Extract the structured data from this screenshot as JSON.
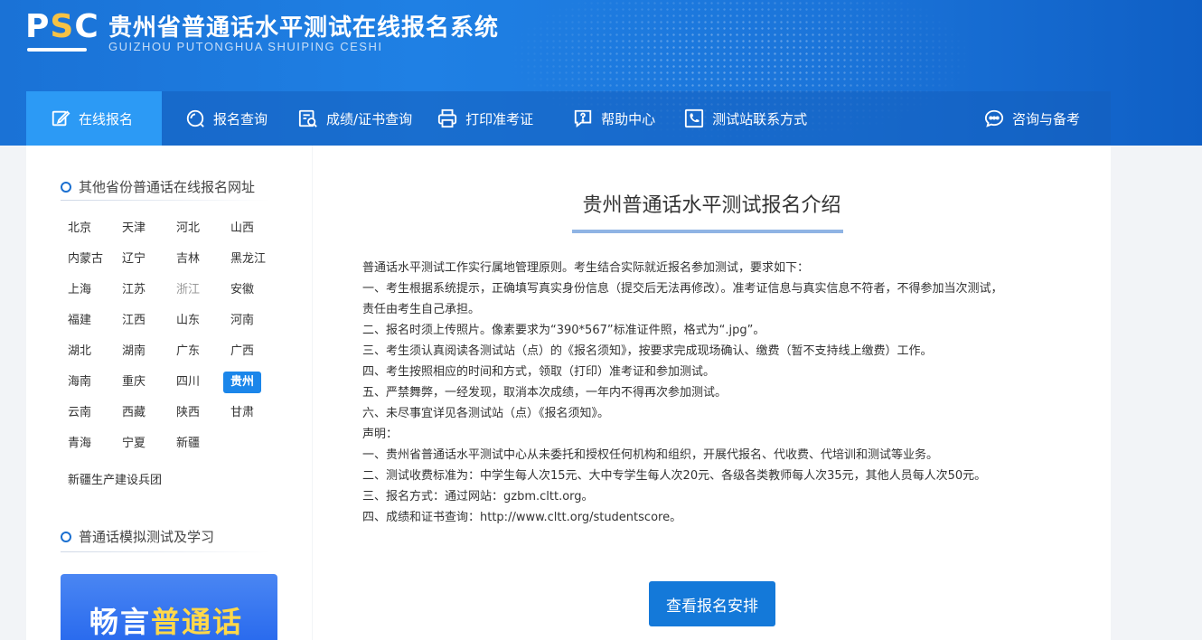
{
  "header": {
    "logo_text_p": "P",
    "logo_text_s": "S",
    "logo_text_c": "C",
    "title_cn": "贵州省普通话水平测试在线报名系统",
    "title_en": "GUIZHOU PUTONGHUA SHUIPING CESHI"
  },
  "nav": {
    "items": [
      {
        "label": "在线报名",
        "icon": "edit-icon",
        "active": true
      },
      {
        "label": "报名查询",
        "icon": "search-icon"
      },
      {
        "label": "成绩/证书查询",
        "icon": "certificate-search-icon"
      },
      {
        "label": "打印准考证",
        "icon": "printer-icon"
      },
      {
        "label": "帮助中心",
        "icon": "help-icon"
      },
      {
        "label": "测试站联系方式",
        "icon": "phone-icon"
      }
    ],
    "right": {
      "label": "咨询与备考",
      "icon": "chat-icon"
    }
  },
  "sidebar": {
    "provinces_title": "其他省份普通话在线报名网址",
    "provinces": [
      [
        "北京",
        "天津",
        "河北",
        "山西"
      ],
      [
        "内蒙古",
        "辽宁",
        "吉林",
        "黑龙江"
      ],
      [
        "上海",
        "江苏",
        "浙江",
        "安徽"
      ],
      [
        "福建",
        "江西",
        "山东",
        "河南"
      ],
      [
        "湖北",
        "湖南",
        "广东",
        "广西"
      ],
      [
        "海南",
        "重庆",
        "四川",
        "贵州"
      ],
      [
        "云南",
        "西藏",
        "陕西",
        "甘肃"
      ],
      [
        "青海",
        "宁夏",
        "新疆"
      ]
    ],
    "province_extra": "新疆生产建设兵团",
    "active_province": "贵州",
    "muted_province": "浙江",
    "practice_title": "普通话模拟测试及学习",
    "banner_text_white": "畅言",
    "banner_text_yellow": "普通话"
  },
  "main": {
    "title": "贵州普通话水平测试报名介绍",
    "paragraphs": [
      "普通话水平测试工作实行属地管理原则。考生结合实际就近报名参加测试，要求如下：",
      "一、考生根据系统提示，正确填写真实身份信息（提交后无法再修改）。准考证信息与真实信息不符者，不得参加当次测试，",
      "责任由考生自己承担。",
      "二、报名时须上传照片。像素要求为“390*567”标准证件照，格式为“.jpg”。",
      "三、考生须认真阅读各测试站（点）的《报名须知》，按要求完成现场确认、缴费（暂不支持线上缴费）工作。",
      "四、考生按照相应的时间和方式，领取（打印）准考证和参加测试。",
      "五、严禁舞弊，一经发现，取消本次成绩，一年内不得再次参加测试。",
      "六、未尽事宜详见各测试站（点）《报名须知》。",
      "声明：",
      "一、贵州省普通话水平测试中心从未委托和授权任何机构和组织，开展代报名、代收费、代培训和测试等业务。",
      "二、测试收费标准为：中学生每人次15元、大中专学生每人次20元、各级各类教师每人次35元，其他人员每人次50元。",
      "三、报名方式：通过网站：gzbm.cltt.org。",
      "四、成绩和证书查询：http://www.cltt.org/studentscore。"
    ],
    "button_label": "查看报名安排"
  },
  "colors": {
    "brand_blue": "#1479d9",
    "nav_active": "#2c9af5",
    "accent_yellow": "#f6c244"
  }
}
